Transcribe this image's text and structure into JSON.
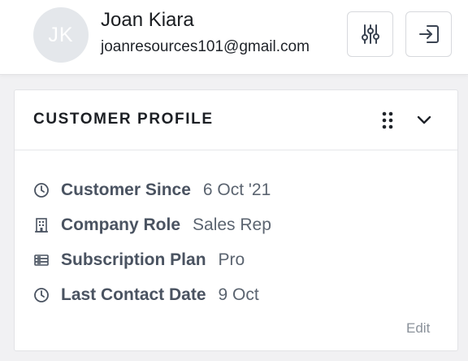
{
  "user": {
    "initials": "JK",
    "name": "Joan Kiara",
    "email": "joanresources101@gmail.com"
  },
  "header_actions": [
    {
      "icon": "sliders-icon"
    },
    {
      "icon": "exit-icon"
    }
  ],
  "card": {
    "title": "CUSTOMER PROFILE",
    "properties": [
      {
        "icon": "clock-icon",
        "label": "Customer Since",
        "value": "6 Oct '21"
      },
      {
        "icon": "building-icon",
        "label": "Company Role",
        "value": "Sales Rep"
      },
      {
        "icon": "stack-icon",
        "label": "Subscription Plan",
        "value": "Pro"
      },
      {
        "icon": "clock-icon",
        "label": "Last Contact Date",
        "value": "9 Oct"
      }
    ],
    "edit_label": "Edit"
  },
  "colors": {
    "avatar_bg": "#e4e7eb",
    "label": "#4a5361",
    "value": "#5b6470",
    "muted": "#8a919a"
  }
}
